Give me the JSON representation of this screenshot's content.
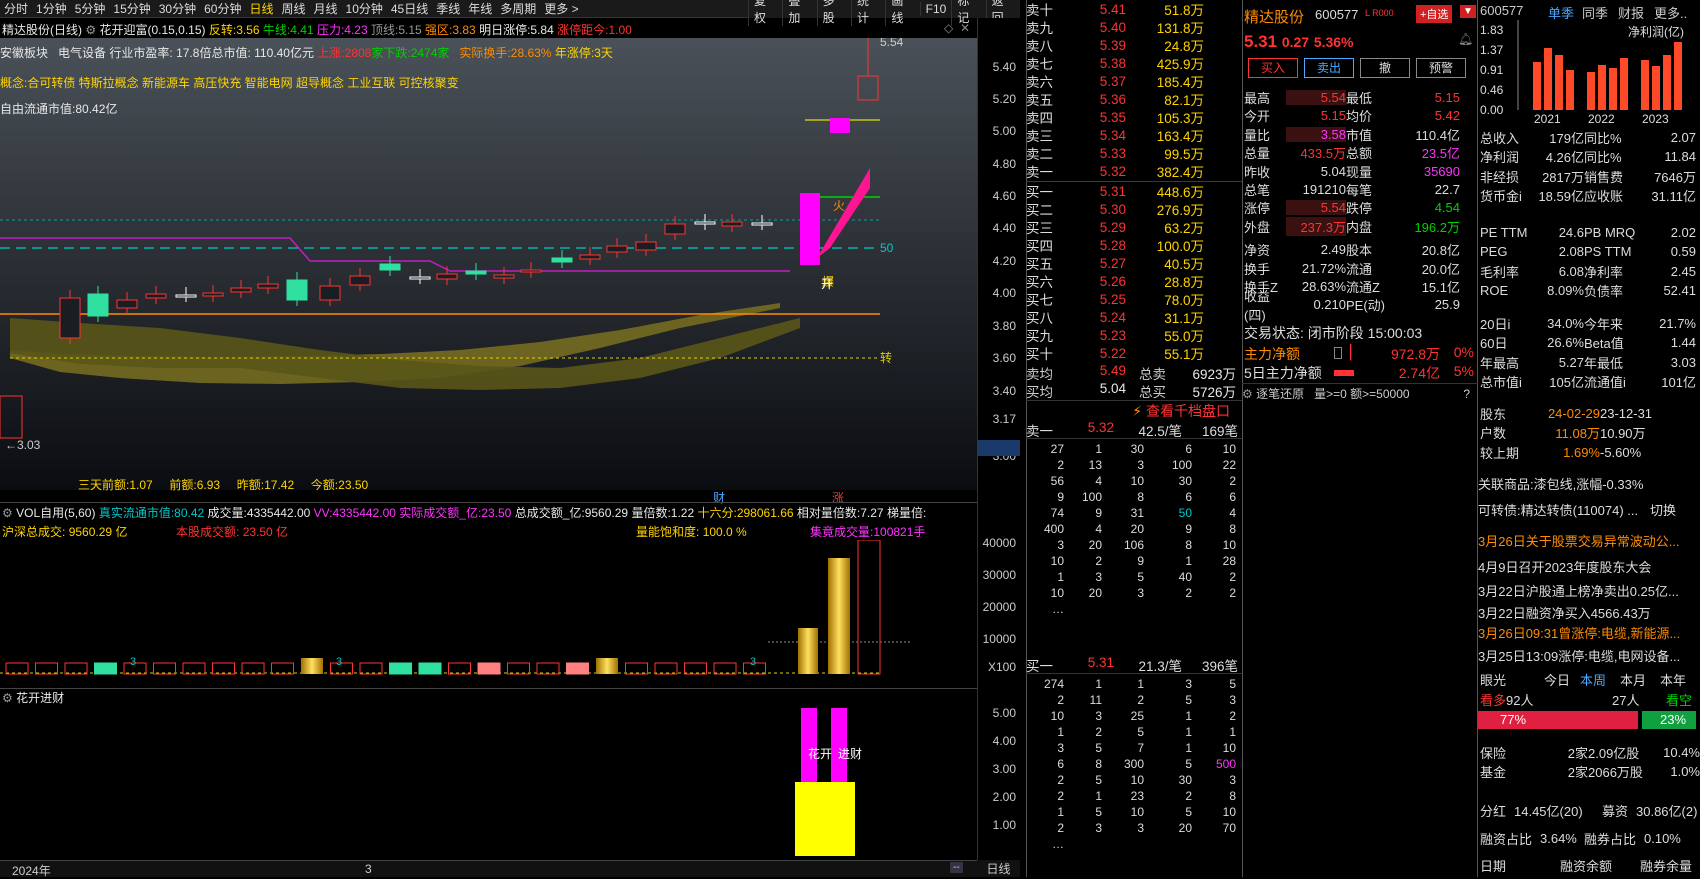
{
  "toolbar": {
    "periods": [
      "分时",
      "1分钟",
      "5分钟",
      "15分钟",
      "30分钟",
      "60分钟",
      "日线",
      "周线",
      "月线",
      "10分钟",
      "45日线",
      "季线",
      "年线",
      "多周期",
      "更多 >"
    ],
    "selected": "日线",
    "right": [
      "复权",
      "叠加",
      "多股",
      "统计",
      "画线",
      "F10",
      "标记",
      "返回"
    ]
  },
  "title": {
    "stock": "精达股份(日线)",
    "indicator": "花开迎富(0.15,0.15)",
    "fanzhuan_l": "反转:",
    "fanzhuan": "3.56",
    "niuxian_l": "牛线:",
    "niuxian": "4.41",
    "yali_l": "压力:",
    "yali": "4.23",
    "dingxian_l": "顶线:",
    "dingxian": "5.15",
    "qiangqu_l": "强区:",
    "qiangqu": "3.83",
    "mrzt_l": "明日涨停:",
    "mrzt": "5.84",
    "ztjj_l": "涨停距今:",
    "ztjj": "1.00"
  },
  "info1": {
    "a": "安徽板块",
    "b": "电气设备",
    "c": "行业市盈率:",
    "d": "17.8",
    "e": "倍总市值:",
    "f": "110.40",
    "g": "亿元",
    "h": "上涨:",
    "i": "2808",
    "j": "家下跌:",
    "k": "2474",
    "l": "家",
    "m": "实际换手:",
    "n": "28.63",
    "o": "%",
    "p": "年涨停:",
    "q": "3天"
  },
  "info2": {
    "label": "概念:",
    "text": "合可转债 特斯拉概念 新能源车 高压快充 智能电网 超导概念 工业互联 可控核聚变"
  },
  "info3": {
    "label": "自由流通市值:",
    "value": "80.42亿"
  },
  "chart": {
    "high_label": "5.54",
    "low_label": "←3.03",
    "line50": "50",
    "zhuan": "转",
    "huo": "火",
    "kai": "开",
    "bao": "爆",
    "qian3_l": "三天前额:",
    "qian3": "1.07",
    "qian_l": "前额:",
    "qian": "6.93",
    "zuo_l": "昨额:",
    "zuo": "17.42",
    "jin_l": "今额:",
    "jin": "23.50",
    "cai": "财",
    "zhang": "涨"
  },
  "yaxis": [
    "5.40",
    "5.20",
    "5.00",
    "4.80",
    "4.60",
    "4.40",
    "4.20",
    "4.00",
    "3.80",
    "3.60",
    "3.40",
    "3.17",
    "3.00"
  ],
  "vol": {
    "title": "VOL自用(5,60)",
    "ltsz_l": "真实流通市值:",
    "ltsz": "80.42",
    "cjl_l": "成交量:",
    "cjl": "4335442.00",
    "vv_l": "VV:",
    "vv": "4335442.00",
    "sjcje_l": "实际成交额_亿:",
    "sjcje": "23.50",
    "zcje_l": "总成交额_亿:",
    "zcje": "9560.29",
    "lbs_l": "量倍数:",
    "lbs": "1.22",
    "sixteen_l": "十六分:",
    "sixteen": "298061.66",
    "xdlbs_l": "相对量倍数:",
    "xdlbs": "7.27",
    "tlb_l": "梯量倍:",
    "hszcj_l": "沪深总成交:",
    "hszcj": "9560.29 亿",
    "bgcje_l": "本股成交额:",
    "bgcje": "23.50 亿",
    "lnbhd_l": "量能饱和度:",
    "lnbhd": "100.0 %",
    "jjcjl_l": "集竟成交量:",
    "jjcjl": "100821手",
    "axis": [
      "40000",
      "30000",
      "20000",
      "10000",
      "X100"
    ]
  },
  "hk": {
    "title": "花开进财",
    "axis": [
      "5.00",
      "4.00",
      "3.00",
      "2.00",
      "1.00"
    ],
    "label1": "花开",
    "label2": "进财"
  },
  "bottom": {
    "year": "2024年",
    "month": "3",
    "period": "日线"
  },
  "ask": [
    [
      "卖十",
      "5.41",
      "51.8万"
    ],
    [
      "卖九",
      "5.40",
      "131.8万"
    ],
    [
      "卖八",
      "5.39",
      "24.8万"
    ],
    [
      "卖七",
      "5.38",
      "425.9万"
    ],
    [
      "卖六",
      "5.37",
      "185.4万"
    ],
    [
      "卖五",
      "5.36",
      "82.1万"
    ],
    [
      "卖四",
      "5.35",
      "105.3万"
    ],
    [
      "卖三",
      "5.34",
      "163.4万"
    ],
    [
      "卖二",
      "5.33",
      "99.5万"
    ],
    [
      "卖一",
      "5.32",
      "382.4万"
    ]
  ],
  "bid": [
    [
      "买一",
      "5.31",
      "448.6万"
    ],
    [
      "买二",
      "5.30",
      "276.9万"
    ],
    [
      "买三",
      "5.29",
      "63.2万"
    ],
    [
      "买四",
      "5.28",
      "100.0万"
    ],
    [
      "买五",
      "5.27",
      "40.5万"
    ],
    [
      "买六",
      "5.26",
      "28.8万"
    ],
    [
      "买七",
      "5.25",
      "78.0万"
    ],
    [
      "买八",
      "5.24",
      "31.1万"
    ],
    [
      "买九",
      "5.23",
      "55.0万"
    ],
    [
      "买十",
      "5.22",
      "55.1万"
    ]
  ],
  "avg": {
    "maijun_l": "卖均",
    "maijun": "5.49",
    "zongmai_l": "总卖",
    "zongmai": "6923万",
    "mairjun_l": "买均",
    "mairjun": "5.04",
    "zongmair_l": "总买",
    "zongmair": "5726万",
    "link": "查看千档盘口"
  },
  "t1": {
    "label": "卖一",
    "price": "5.32",
    "per": "42.5/笔",
    "count": "169笔",
    "rows": [
      [
        "27",
        "1",
        "30",
        "6",
        "10"
      ],
      [
        "2",
        "13",
        "3",
        "100",
        "22"
      ],
      [
        "56",
        "4",
        "10",
        "30",
        "2"
      ],
      [
        "9",
        "100",
        "8",
        "6",
        "6"
      ],
      [
        "74",
        "9",
        "31",
        "50",
        "4"
      ],
      [
        "400",
        "4",
        "20",
        "9",
        "8"
      ],
      [
        "3",
        "20",
        "106",
        "8",
        "10"
      ],
      [
        "10",
        "2",
        "9",
        "1",
        "28"
      ],
      [
        "1",
        "3",
        "5",
        "40",
        "2"
      ],
      [
        "10",
        "20",
        "3",
        "2",
        "2"
      ]
    ],
    "dots": "…"
  },
  "t2": {
    "label": "买一",
    "price": "5.31",
    "per": "21.3/笔",
    "count": "396笔",
    "rows": [
      [
        "274",
        "1",
        "1",
        "3",
        "5"
      ],
      [
        "2",
        "11",
        "2",
        "5",
        "3"
      ],
      [
        "10",
        "3",
        "25",
        "1",
        "2"
      ],
      [
        "1",
        "2",
        "5",
        "1",
        "1"
      ],
      [
        "3",
        "5",
        "7",
        "1",
        "10"
      ],
      [
        "6",
        "8",
        "300",
        "5",
        "500"
      ],
      [
        "2",
        "5",
        "10",
        "30",
        "3"
      ],
      [
        "2",
        "1",
        "23",
        "2",
        "8"
      ],
      [
        "1",
        "5",
        "10",
        "5",
        "10"
      ],
      [
        "2",
        "3",
        "3",
        "20",
        "70"
      ]
    ],
    "dots": "…"
  },
  "quote": {
    "name": "精达股份",
    "code": "600577",
    "tag": "L R000",
    "zixuan": "+自选",
    "price": "5.31",
    "chg": "0.27",
    "pct": "5.36%",
    "buy": "买入",
    "sell": "卖出",
    "cancel": "撤",
    "alert": "预警",
    "rows": [
      [
        "最高",
        "5.54",
        "最低",
        "5.15"
      ],
      [
        "今开",
        "5.15",
        "均价",
        "5.42"
      ],
      [
        "量比",
        "3.58",
        "市值",
        "110.4亿"
      ],
      [
        "总量",
        "433.5万",
        "总额",
        "23.5亿"
      ],
      [
        "昨收",
        "5.04",
        "现量",
        "35690"
      ],
      [
        "总笔",
        "191210",
        "每笔",
        "22.7"
      ],
      [
        "涨停",
        "5.54",
        "跌停",
        "4.54"
      ],
      [
        "外盘",
        "237.3万",
        "内盘",
        "196.2万"
      ],
      [
        "净资",
        "2.49",
        "股本",
        "20.8亿"
      ],
      [
        "换手",
        "21.72%",
        "流通",
        "20.0亿"
      ],
      [
        "换手Z",
        "28.63%",
        "流通Z",
        "15.1亿"
      ],
      [
        "收益(四)",
        "0.210",
        "PE(动)",
        "25.9"
      ]
    ],
    "status": "交易状态: 闭市阶段 15:00:03",
    "zlje_l": "主力净额",
    "zlje": "972.8万",
    "zlje_p": "0%",
    "zl5_l": "5日主力净额",
    "zl5": "2.74亿",
    "zl5_p": "5%",
    "zbhy": "逐笔还原",
    "filter": "量>=0 额>=50000",
    "q": "?"
  },
  "rp": {
    "code": "600577",
    "t1": "单季",
    "t2": "同季",
    "t3": "财报",
    "t4": "更多..",
    "yaxis": [
      "1.83",
      "1.37",
      "0.91",
      "0.46",
      "0.00"
    ],
    "chart_label": "净利润(亿)",
    "years": [
      "2021",
      "2022",
      "2023"
    ],
    "rows1": [
      [
        "总收入",
        "179亿",
        "同比%",
        "2.07"
      ],
      [
        "净利润",
        "4.26亿",
        "同比%",
        "11.84"
      ],
      [
        "非经损",
        "2817万",
        "销售费",
        "7646万"
      ],
      [
        "货币金i",
        "18.59亿",
        "应收账",
        "31.11亿"
      ]
    ],
    "rows2": [
      [
        "PE TTM",
        "24.6",
        "PB MRQ",
        "2.02"
      ],
      [
        "PEG",
        "2.08",
        "PS TTM",
        "0.59"
      ],
      [
        "毛利率",
        "6.08",
        "净利率",
        "2.45"
      ],
      [
        "ROE",
        "8.09%",
        "负债率",
        "52.41"
      ]
    ],
    "rows3": [
      [
        "20日i",
        "34.0%",
        "今年来",
        "21.7%"
      ],
      [
        "60日",
        "26.6%",
        "Beta值",
        "1.44"
      ],
      [
        "年最高",
        "5.27",
        "年最低",
        "3.03"
      ],
      [
        "总市值i",
        "105亿",
        "流通值i",
        "101亿"
      ]
    ],
    "rows4": [
      [
        "股东",
        "24-02-29",
        "23-12-31"
      ],
      [
        "户数",
        "11.08万",
        "10.90万"
      ],
      [
        "较上期",
        "1.69%",
        "-5.60%"
      ]
    ],
    "glsp": "关联商品:漆包线,涨幅-0.33%",
    "kzz": "可转债:精达转债(110074) ...",
    "qh": "切换",
    "news": [
      "3月26日关于股票交易异常波动公...",
      "4月9日召开2023年度股东大会",
      "3月22日沪股通上榜净卖出0.25亿...",
      "3月22日融资净买入4566.43万",
      "3月26日09:31曾涨停:电缆,新能源...",
      "3月25日13:09涨停:电缆,电网设备..."
    ],
    "yg": "眼光",
    "jr": "今日",
    "bz": "本周",
    "by": "本月",
    "bn": "本年",
    "kd": "看多",
    "kd_n": "92人",
    "kk_n": "27人",
    "kk": "看空",
    "kd_p": "77%",
    "kk_p": "23%",
    "rows5": [
      [
        "保险",
        "2家",
        "2.09亿股",
        "10.4%"
      ],
      [
        "基金",
        "2家",
        "2066万股",
        "1.0%"
      ]
    ],
    "fh": "分红",
    "fh_v": "14.45亿(20)",
    "mz": "募资",
    "mz_v": "30.86亿(2)",
    "rzzb_l": "融资占比",
    "rzzb": "3.64%",
    "rqzb_l": "融券占比",
    "rqzb": "0.10%",
    "rq": "日期",
    "rzye": "融资余额",
    "rqye": "融券余量"
  }
}
